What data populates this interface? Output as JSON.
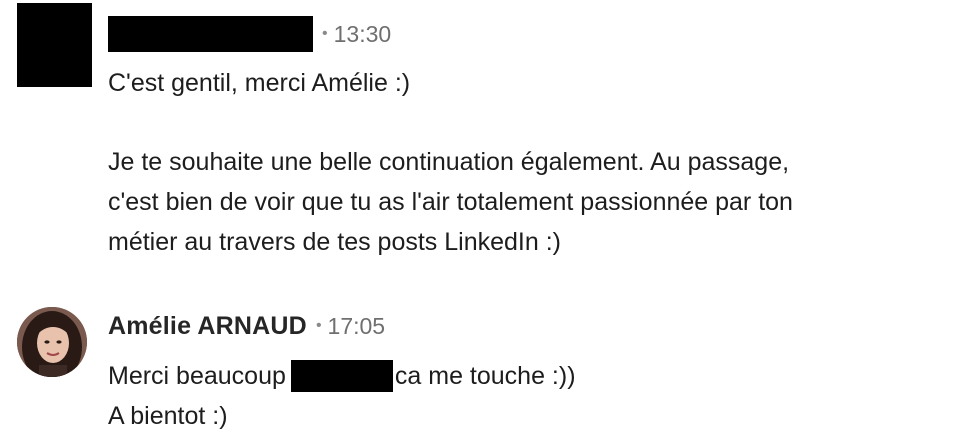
{
  "conversation": {
    "messages": [
      {
        "sender": "",
        "time": "13:30",
        "lines": [
          "C'est gentil, merci Amélie :)",
          "Je te souhaite une belle continuation également. Au passage,",
          "c'est bien de voir que tu as l'air totalement passionnée par ton",
          "métier au travers de tes posts LinkedIn :)"
        ]
      },
      {
        "sender": "Amélie ARNAUD",
        "time": "17:05",
        "line1_before": "Merci beaucoup",
        "line1_after": "ca me touche :))",
        "line2": "A bientot :)"
      }
    ],
    "separator": "•"
  },
  "colors": {
    "text": "#1d1d1d",
    "meta": "#6f6f6f",
    "redaction": "#000000",
    "background": "#ffffff"
  }
}
